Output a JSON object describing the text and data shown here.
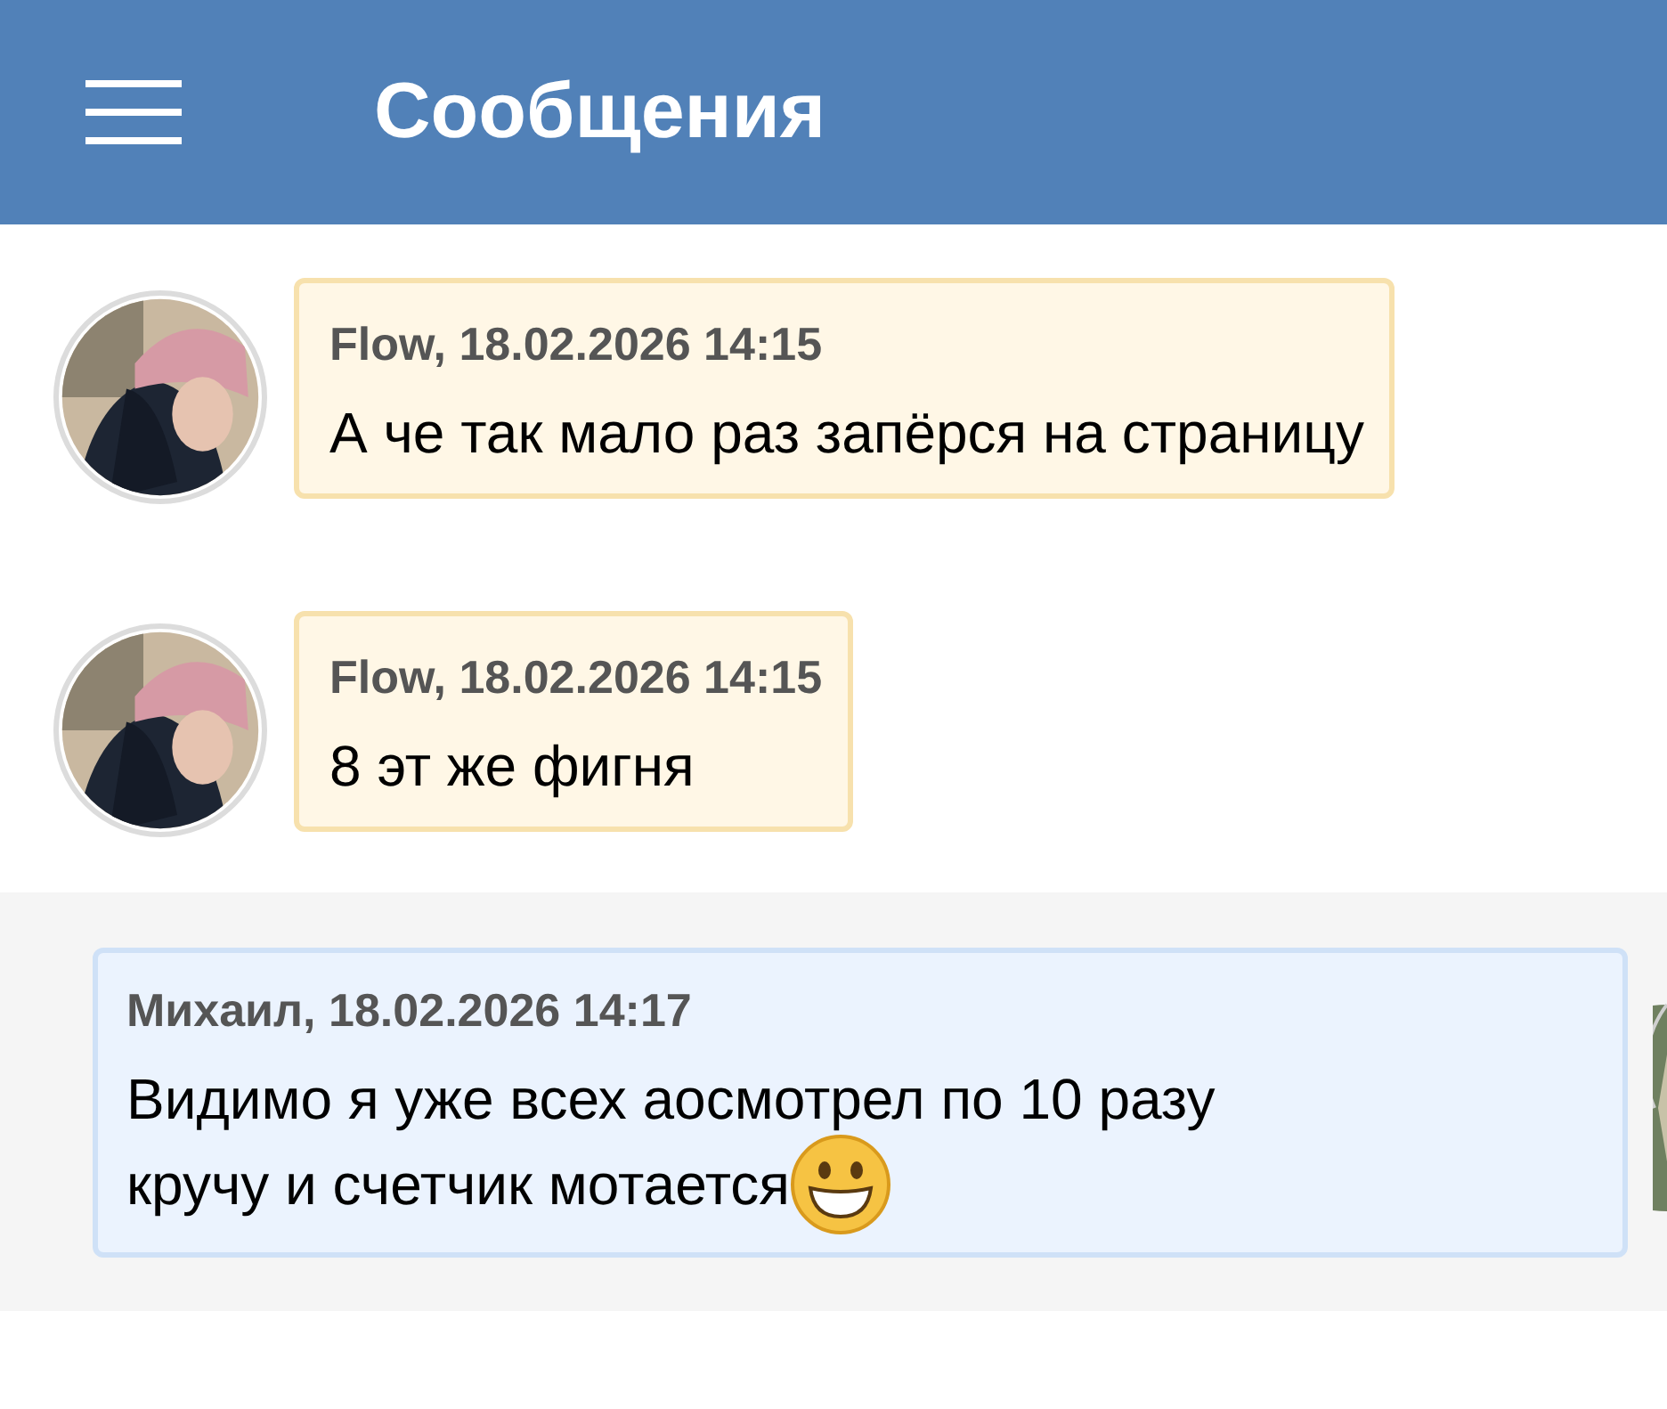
{
  "header": {
    "title": "Сообщения"
  },
  "messages": [
    {
      "kind": "incoming",
      "author": "Flow, 18.02.2026 14:15",
      "lines": [
        "А че так мало раз запёрся на страницу"
      ],
      "emoji": false
    },
    {
      "kind": "incoming",
      "author": "Flow, 18.02.2026 14:15",
      "lines": [
        "8 эт же фигня"
      ],
      "emoji": false
    },
    {
      "kind": "outgoing",
      "author": "Михаил, 18.02.2026 14:17",
      "lines": [
        "Видимо я уже всех аосмотрел по 10 разу",
        "кручу и счетчик мотается"
      ],
      "emoji": true
    }
  ]
}
